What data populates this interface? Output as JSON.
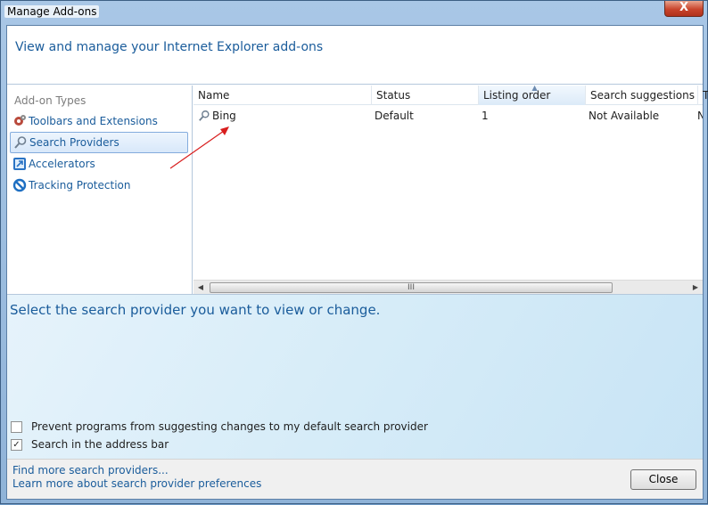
{
  "window": {
    "title": "Manage Add-ons",
    "close_glyph": "X"
  },
  "header": {
    "text": "View and manage your Internet Explorer add-ons"
  },
  "addon_types": {
    "heading": "Add-on Types",
    "items": [
      {
        "label": "Toolbars and Extensions",
        "icon": "gear-icon",
        "selected": false
      },
      {
        "label": "Search Providers",
        "icon": "search-icon",
        "selected": true
      },
      {
        "label": "Accelerators",
        "icon": "accelerator-icon",
        "selected": false
      },
      {
        "label": "Tracking Protection",
        "icon": "no-entry-icon",
        "selected": false
      }
    ]
  },
  "list": {
    "columns": [
      "Name",
      "Status",
      "Listing order",
      "Search suggestions",
      "T"
    ],
    "sorted_column": "Listing order",
    "rows": [
      {
        "name": "Bing",
        "status": "Default",
        "listing_order": "1",
        "search_suggestions": "Not Available",
        "truncated": "N"
      }
    ],
    "scrollbar_grip": "III"
  },
  "details": {
    "title": "Select the search provider you want to view or change.",
    "checkboxes": [
      {
        "label": "Prevent programs from suggesting changes to my default search provider",
        "checked": false
      },
      {
        "label": "Search in the address bar",
        "checked": true
      }
    ]
  },
  "footer": {
    "links": [
      "Find more search providers...",
      "Learn more about search provider preferences"
    ],
    "close_label": "Close"
  },
  "colors": {
    "accent_text": "#1a5c9b",
    "annotation_arrow": "#d81e1e"
  }
}
